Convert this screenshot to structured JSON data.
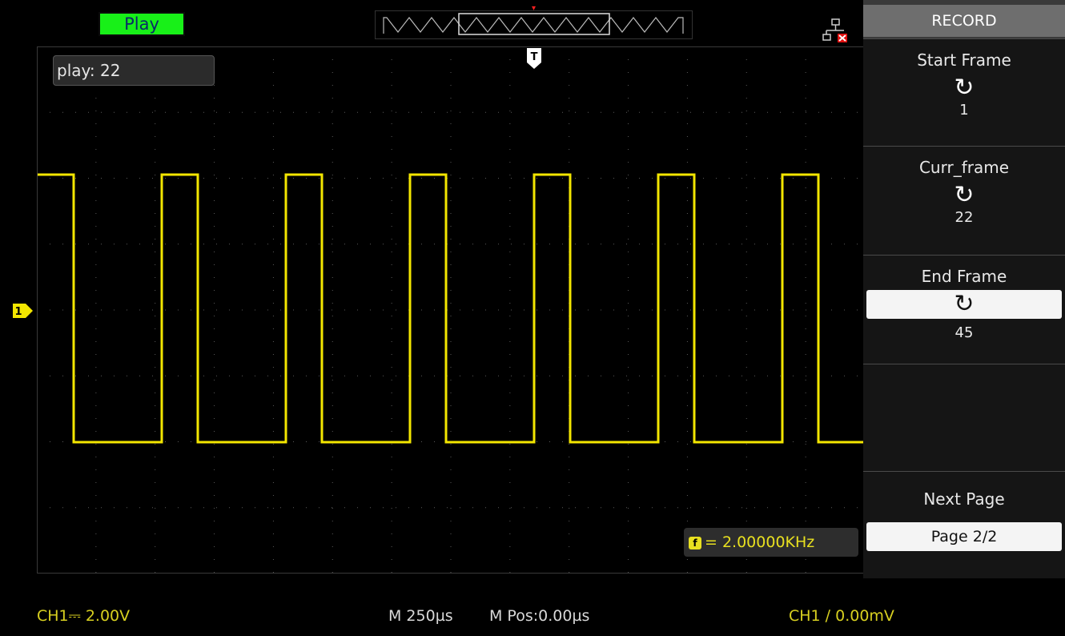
{
  "status": {
    "mode": "Play"
  },
  "waveform": {
    "play_label": "play: 22",
    "frequency": "= 2.00000KHz",
    "color": "#f3e600"
  },
  "menu": {
    "title": "RECORD",
    "items": [
      {
        "label": "Start Frame",
        "value": "1"
      },
      {
        "label": "Curr_frame",
        "value": "22"
      },
      {
        "label": "End Frame",
        "value": "45"
      },
      {
        "label": "",
        "value": ""
      },
      {
        "label": "Next Page",
        "value": "Page 2/2"
      }
    ]
  },
  "bottom": {
    "ch1_scale": "CH1⎓ 2.00V",
    "timebase": "M 250µs",
    "mpos": "M Pos:0.00µs",
    "trigger": "CH1 ∕ 0.00mV"
  },
  "icons": {
    "knob": "rotate-knob-icon",
    "network": "network-disconnected-icon"
  }
}
